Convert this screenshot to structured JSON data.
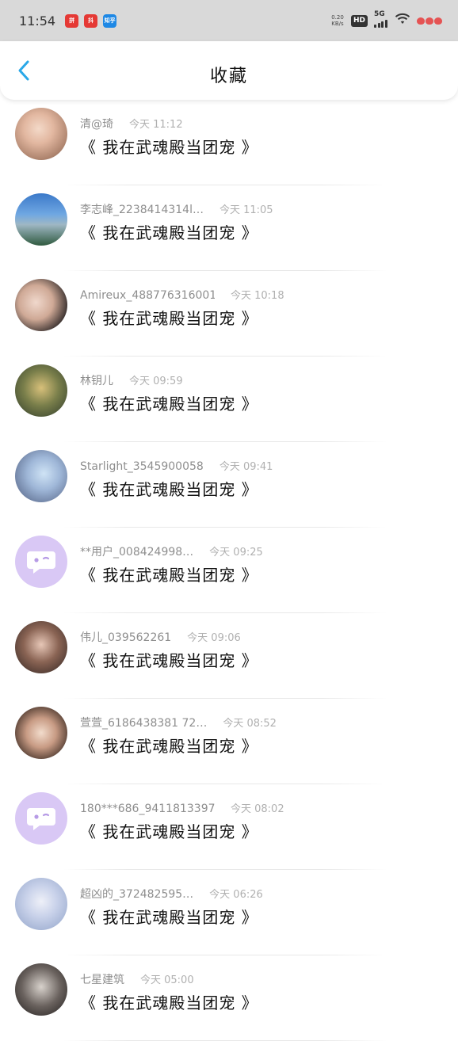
{
  "status_bar": {
    "time": "11:54",
    "net_speed_value": "0.20",
    "net_speed_unit": "KB/s",
    "hd_label": "HD",
    "signal_label": "5G",
    "apps": [
      {
        "name": "app-icon-red",
        "color": "#e53935",
        "label": "拼"
      },
      {
        "name": "app-icon-red-2",
        "color": "#e53935",
        "label": "抖"
      },
      {
        "name": "app-icon-blue",
        "color": "#1e88e5",
        "label": "知乎"
      }
    ]
  },
  "header": {
    "title": "收藏",
    "back_icon": "chevron-left-icon",
    "accent_color": "#2aa8e8"
  },
  "items": [
    {
      "username": "清@琦",
      "time": "今天 11:12",
      "content": "《 我在武魂殿当团宠 》",
      "avatar": "photo-avatar"
    },
    {
      "username": "李志峰_2238414314l…",
      "time": "今天 11:05",
      "content": "《 我在武魂殿当团宠 》",
      "avatar": "photo-avatar"
    },
    {
      "username": "Amireux_488776316001",
      "time": "今天 10:18",
      "content": "《 我在武魂殿当团宠 》",
      "avatar": "photo-avatar"
    },
    {
      "username": "林钥儿",
      "time": "今天 09:59",
      "content": "《 我在武魂殿当团宠 》",
      "avatar": "photo-avatar"
    },
    {
      "username": "Starlight_3545900058",
      "time": "今天 09:41",
      "content": "《 我在武魂殿当团宠 》",
      "avatar": "photo-avatar"
    },
    {
      "username": "**用户_008424998…",
      "time": "今天 09:25",
      "content": "《 我在武魂殿当团宠 》",
      "avatar": "default-avatar"
    },
    {
      "username": "伟儿_039562261",
      "time": "今天 09:06",
      "content": "《 我在武魂殿当团宠 》",
      "avatar": "photo-avatar"
    },
    {
      "username": "萱萱_6186438381 72…",
      "time": "今天 08:52",
      "content": "《 我在武魂殿当团宠 》",
      "avatar": "photo-avatar"
    },
    {
      "username": "180***686_9411813397",
      "time": "今天 08:02",
      "content": "《 我在武魂殿当团宠 》",
      "avatar": "default-avatar"
    },
    {
      "username": "超凶的_372482595…",
      "time": "今天 06:26",
      "content": "《 我在武魂殿当团宠 》",
      "avatar": "photo-avatar"
    },
    {
      "username": "七星建筑",
      "time": "今天 05:00",
      "content": "《 我在武魂殿当团宠 》",
      "avatar": "photo-avatar"
    }
  ]
}
